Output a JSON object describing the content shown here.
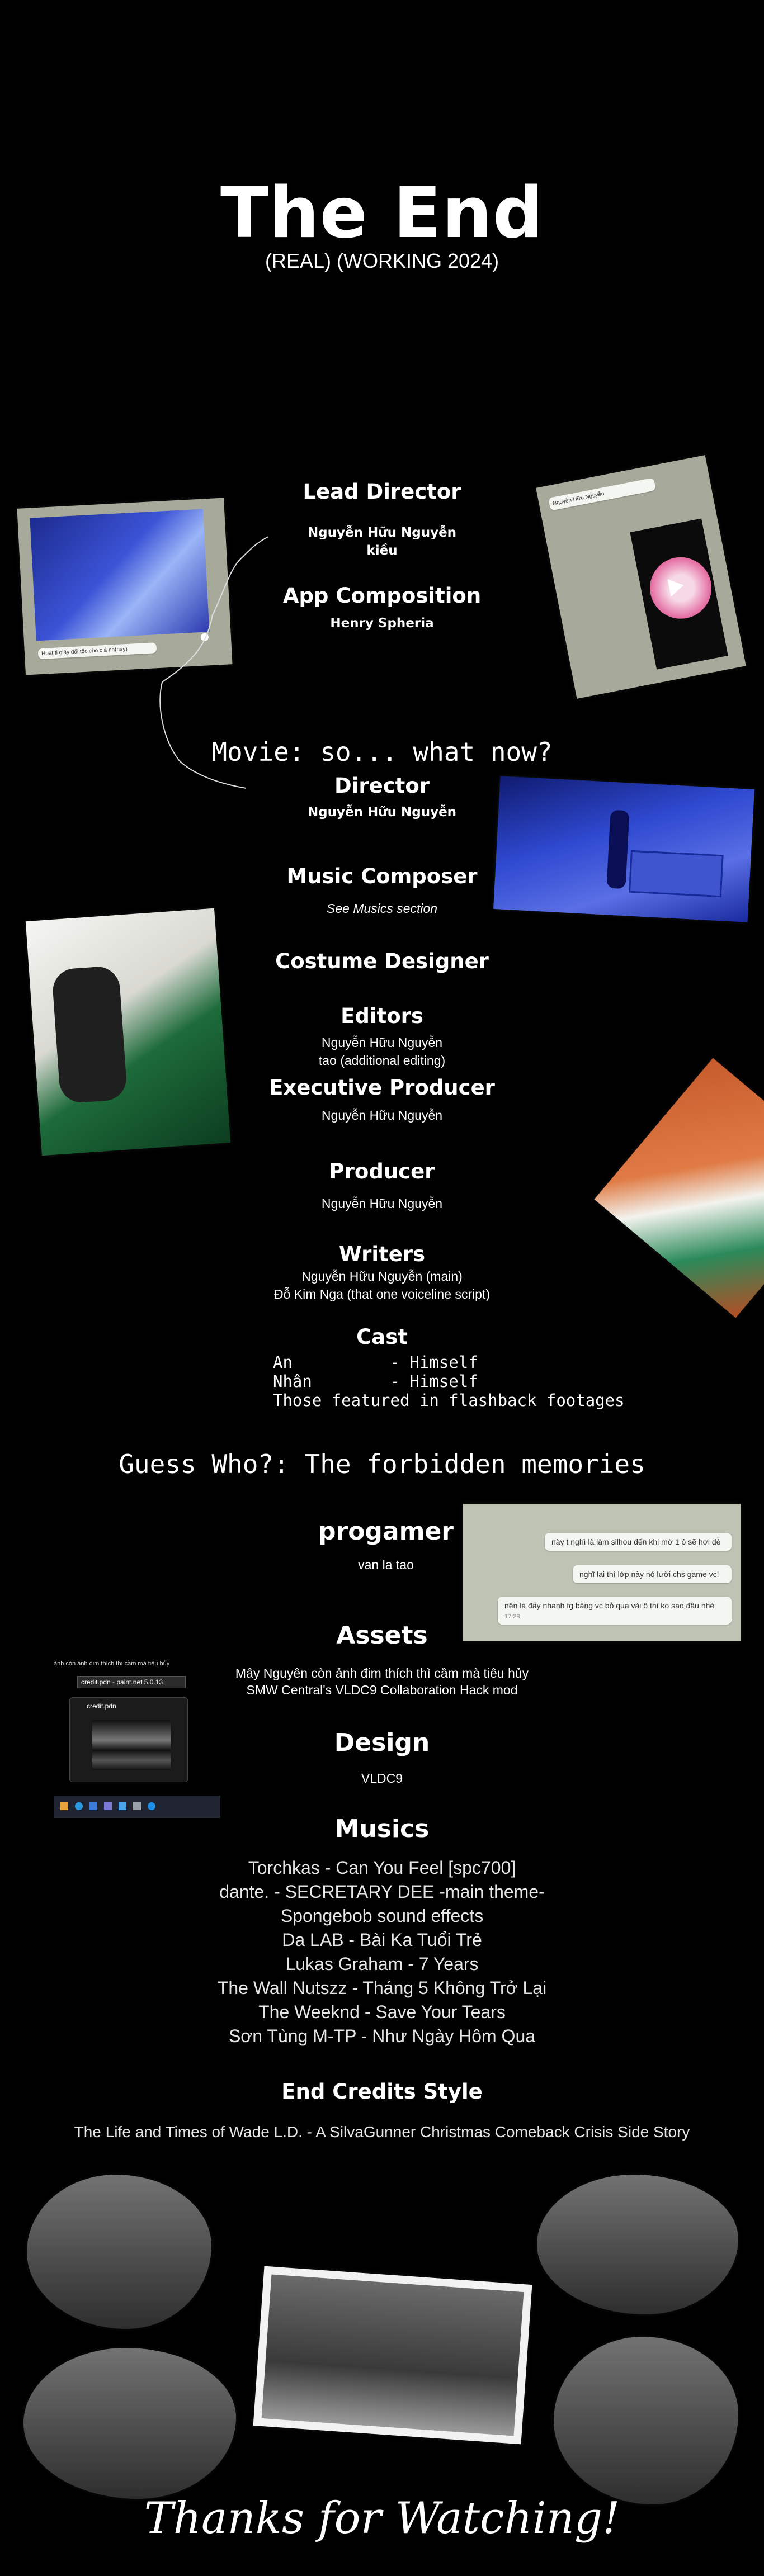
{
  "title": "The End",
  "subtitle": "(REAL) (WORKING 2024)",
  "sections": {
    "lead_director_heading": "Lead Director",
    "lead_director_name_line1": "Nguyễn Hữu Nguyễn",
    "lead_director_name_line2": "kiều",
    "app_composition_heading": "App Composition",
    "app_composition_name": "Henry Spheria",
    "movie_heading": "Movie: so... what now?",
    "director_heading": "Director",
    "director_name": "Nguyễn Hữu Nguyễn",
    "music_composer_heading": "Music Composer",
    "music_composer_note": "See Musics section",
    "costume_designer_heading": "Costume Designer",
    "editors_heading": "Editors",
    "editors_line1": "Nguyễn Hữu Nguyễn",
    "editors_line2": "tao (additional editing)",
    "executive_producer_heading": "Executive Producer",
    "executive_producer_name": "Nguyễn Hữu Nguyễn",
    "producer_heading": "Producer",
    "producer_name": "Nguyễn Hữu Nguyễn",
    "writers_heading": "Writers",
    "writers_line1": "Nguyễn Hữu Nguyễn (main)",
    "writers_line2": "Đỗ Kim Nga (that one voiceline script)",
    "cast_heading": "Cast",
    "cast_lines": "An          - Himself\nNhân        - Himself\nThose featured in flashback footages",
    "guess_heading": "Guess Who?: The forbidden memories",
    "progamer_heading": "progamer",
    "progamer_name": "van la tao",
    "assets_heading": "Assets",
    "assets_line1": "Mây Nguyên còn ảnh đim thích thì cầm mà tiêu hủy",
    "assets_line2": "SMW Central's VLDC9 Collaboration Hack mod",
    "design_heading": "Design",
    "design_name": "VLDC9",
    "musics_heading": "Musics",
    "musics": [
      "Torchkas - Can You Feel [spc700]",
      "dante. - SECRETARY DEE -main theme-",
      "Spongebob sound effects",
      "Da LAB - Bài Ka Tuổi Trẻ",
      "Lukas Graham - 7 Years",
      "The Wall Nutszz - Tháng 5 Không Trở Lại",
      "The Weeknd - Save Your Tears",
      "Sơn Tùng M-TP - Như Ngày Hôm Qua"
    ],
    "end_credits_heading": "End Credits Style",
    "end_credits_line": "The Life and Times of Wade L.D. - A SilvaGunner Christmas Comeback Crisis Side Story",
    "thanks": "Thanks for Watching!"
  },
  "chat_bubbles": [
    "này t nghĩ là làm silhou đến khi mờ 1 ô sẽ hơi dễ",
    "nghĩ lại thì lớp này nó lười chs game vc!",
    "nên là đấy nhanh tg bằng vc bỏ qua vài ô thì ko sao đâu nhé"
  ],
  "chat_time": "17:28",
  "taskbar_file": "credit.pdn - paint.net 5.0.13",
  "taskbar_thumb_title": "credit.pdn",
  "taskbar_caption": "ảnh còn ảnh đim thích thì cầm mà tiêu hủy",
  "phone_caption": "Nguyễn Hữu Nguyễn",
  "tl_caption": "Hoát ti giây đối tốc cho c á nh(hay)"
}
